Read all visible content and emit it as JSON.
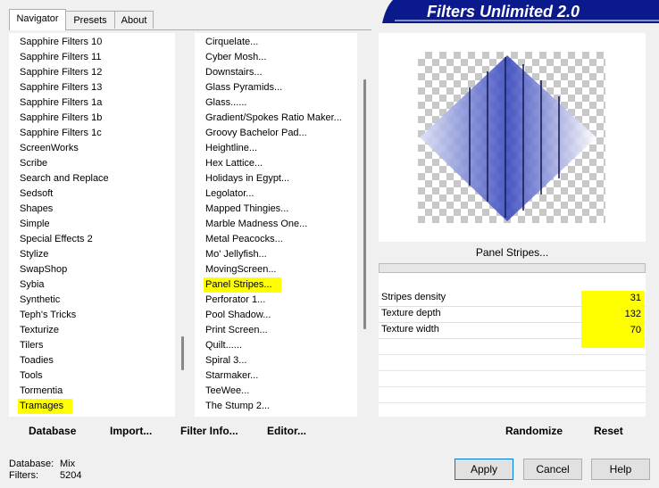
{
  "tabs": [
    {
      "label": "Navigator"
    },
    {
      "label": "Presets"
    },
    {
      "label": "About"
    }
  ],
  "banner": {
    "title": "Filters Unlimited 2.0"
  },
  "categories": [
    "Sapphire Filters 10",
    "Sapphire Filters 11",
    "Sapphire Filters 12",
    "Sapphire Filters 13",
    "Sapphire Filters 1a",
    "Sapphire Filters 1b",
    "Sapphire Filters 1c",
    "ScreenWorks",
    "Scribe",
    "Search and Replace",
    "Sedsoft",
    "Shapes",
    "Simple",
    "Special Effects 2",
    "Stylize",
    "SwapShop",
    "Sybia",
    "Synthetic",
    "Teph's Tricks",
    "Texturize",
    "Tilers",
    "Toadies",
    "Tools",
    "Tormentia",
    "Tramages"
  ],
  "filters": [
    "Cirquelate...",
    "Cyber Mosh...",
    "Downstairs...",
    "Glass Pyramids...",
    "Glass......",
    "Gradient/Spokes Ratio Maker...",
    "Groovy Bachelor Pad...",
    "Heightline...",
    "Hex Lattice...",
    "Holidays in Egypt...",
    "Legolator...",
    "Mapped Thingies...",
    "Marble Madness One...",
    "Metal Peacocks...",
    "Mo' Jellyfish...",
    "MovingScreen...",
    "Panel Stripes...",
    "Perforator 1...",
    "Pool Shadow...",
    "Print Screen...",
    "Quilt......",
    "Spiral 3...",
    "Starmaker...",
    "TeeWee...",
    "The Stump 2..."
  ],
  "toolbar": {
    "database": "Database",
    "import": "Import...",
    "filter_info": "Filter Info...",
    "editor": "Editor...",
    "randomize": "Randomize",
    "reset": "Reset"
  },
  "preview": {
    "filter_name": "Panel Stripes..."
  },
  "params": [
    {
      "label": "Stripes density",
      "value": "31"
    },
    {
      "label": "Texture depth",
      "value": "132"
    },
    {
      "label": "Texture width",
      "value": "70"
    }
  ],
  "status": {
    "database_label": "Database:",
    "database_value": "Mix",
    "filters_label": "Filters:",
    "filters_value": "5204"
  },
  "buttons": {
    "apply": "Apply",
    "cancel": "Cancel",
    "help": "Help"
  },
  "colors": {
    "highlight": "#ffff00",
    "banner_bg": "#0a1a8c",
    "accent": "#0078d7"
  }
}
